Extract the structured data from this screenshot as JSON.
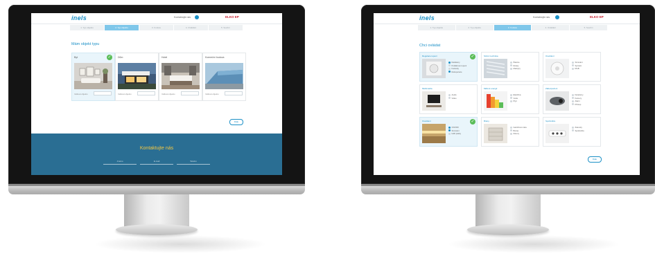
{
  "site": {
    "logo": "inels",
    "header_link": "Kontaktujte nás",
    "brand": "ELKO EP"
  },
  "left_screen": {
    "steps": [
      "1. Typ objektu",
      "2. Typ objektu",
      "3. Funkce",
      "4. Ovládání",
      "5. Souhrn"
    ],
    "active_step": 1,
    "title": "Mám objekt typu",
    "cards": [
      {
        "label": "Byt",
        "selected": true,
        "field_label": "Velikost objektu",
        "select": ""
      },
      {
        "label": "Dům",
        "selected": false,
        "field_label": "Velikost objektu",
        "select": ""
      },
      {
        "label": "Hotel",
        "selected": false,
        "field_label": "Velikost objektu",
        "select": ""
      },
      {
        "label": "Komerční budova",
        "selected": false,
        "field_label": "Velikost objektu",
        "select": ""
      }
    ],
    "next_label": "Dále",
    "footer": {
      "title": "Kontaktujte nás",
      "fields": [
        "Jméno",
        "E-mail",
        "Telefon"
      ]
    },
    "colors": {
      "accent": "#1a8fc6",
      "footer": "#2a6e93",
      "footer_title": "#f5c842",
      "check": "#5bbd58"
    }
  },
  "right_screen": {
    "steps": [
      "1. Typ objektu",
      "2. Typ objektu",
      "3. Funkce",
      "4. Ovládání",
      "5. Souhrn"
    ],
    "active_step": 2,
    "title": "Chci ovládat",
    "cards": [
      {
        "title": "Regulace topení",
        "selected": true,
        "items": [
          {
            "t": "Radiátory",
            "on": true
          },
          {
            "t": "Podlahové topení",
            "on": false
          },
          {
            "t": "Fankoily",
            "on": false
          },
          {
            "t": "Rekuperace",
            "on": true
          }
        ]
      },
      {
        "title": "Stínící technika",
        "selected": false,
        "items": [
          {
            "t": "Žaluzie",
            "on": false
          },
          {
            "t": "Rolety",
            "on": false
          },
          {
            "t": "Markýzy",
            "on": false
          }
        ]
      },
      {
        "title": "Osvětlení",
        "selected": false,
        "items": [
          {
            "t": "Stmívání",
            "on": false
          },
          {
            "t": "Spínání",
            "on": false
          },
          {
            "t": "RGB",
            "on": false
          }
        ]
      },
      {
        "title": "Multimédia",
        "selected": false,
        "items": [
          {
            "t": "Audio",
            "on": false
          },
          {
            "t": "Video",
            "on": false
          }
        ]
      },
      {
        "title": "Měření energií",
        "selected": false,
        "items": [
          {
            "t": "Elektřina",
            "on": false
          },
          {
            "t": "Voda",
            "on": false
          },
          {
            "t": "Plyn",
            "on": false
          }
        ]
      },
      {
        "title": "Zabezpečení",
        "selected": false,
        "items": [
          {
            "t": "Detektory",
            "on": false
          },
          {
            "t": "Kamery",
            "on": false
          },
          {
            "t": "Alarm",
            "on": false
          },
          {
            "t": "Přístup",
            "on": false
          }
        ]
      },
      {
        "title": "Osvětlení",
        "selected": true,
        "items": [
          {
            "t": "ON/OFF",
            "on": true
          },
          {
            "t": "Stmívání",
            "on": true
          },
          {
            "t": "LED pásky",
            "on": false
          }
        ]
      },
      {
        "title": "Brány",
        "selected": false,
        "items": [
          {
            "t": "Garážová vrata",
            "on": false
          },
          {
            "t": "Brána",
            "on": false
          },
          {
            "t": "Závory",
            "on": false
          }
        ]
      },
      {
        "title": "Spotřebiče",
        "selected": false,
        "items": [
          {
            "t": "Zásuvky",
            "on": false
          },
          {
            "t": "Spotřebiče",
            "on": false
          }
        ]
      }
    ],
    "next_label": "Dále"
  }
}
